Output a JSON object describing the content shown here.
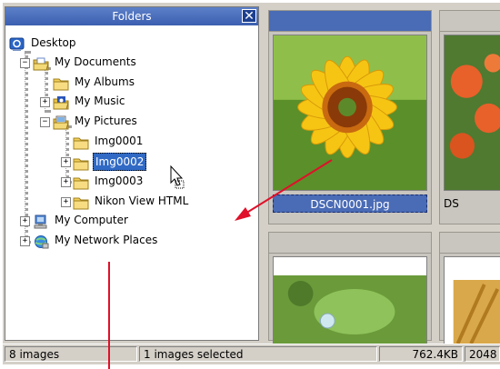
{
  "folders_pane": {
    "title": "Folders",
    "close_glyph": "✕",
    "tree": [
      {
        "label": "Desktop",
        "icon": "desktop-icon"
      },
      {
        "label": "My Documents",
        "icon": "folder-open-icon",
        "expander": "−"
      },
      {
        "label": "My Albums",
        "icon": "folder-icon"
      },
      {
        "label": "My Music",
        "icon": "folder-music-icon",
        "expander": "+"
      },
      {
        "label": "My Pictures",
        "icon": "folder-pictures-icon",
        "expander": "−"
      },
      {
        "label": "Img0001",
        "icon": "folder-icon"
      },
      {
        "label": "Img0002",
        "icon": "folder-icon",
        "expander": "+",
        "selected": true
      },
      {
        "label": "Img0003",
        "icon": "folder-icon",
        "expander": "+"
      },
      {
        "label": "Nikon View HTML",
        "icon": "folder-icon",
        "expander": "+"
      },
      {
        "label": "My Computer",
        "icon": "computer-icon",
        "expander": "+"
      },
      {
        "label": "My Network Places",
        "icon": "network-icon",
        "expander": "+"
      }
    ]
  },
  "thumbnails": [
    {
      "caption": "DSCN0001.jpg",
      "selected": true,
      "image": "sunflower"
    },
    {
      "caption": "DS",
      "selected": false,
      "image": "orange-lilies"
    },
    {
      "caption": "",
      "selected": false,
      "image": "leaf-water-drop"
    },
    {
      "caption": "",
      "selected": false,
      "image": "wheat"
    }
  ],
  "status_bar": {
    "image_count": "8 images",
    "selected_count": "1 images selected",
    "size": "762.4KB",
    "dimensions": "2048"
  },
  "colors": {
    "selection": "#316ac5",
    "annotation_arrow": "#e0102a",
    "header_blue": "#4a6bb5"
  }
}
